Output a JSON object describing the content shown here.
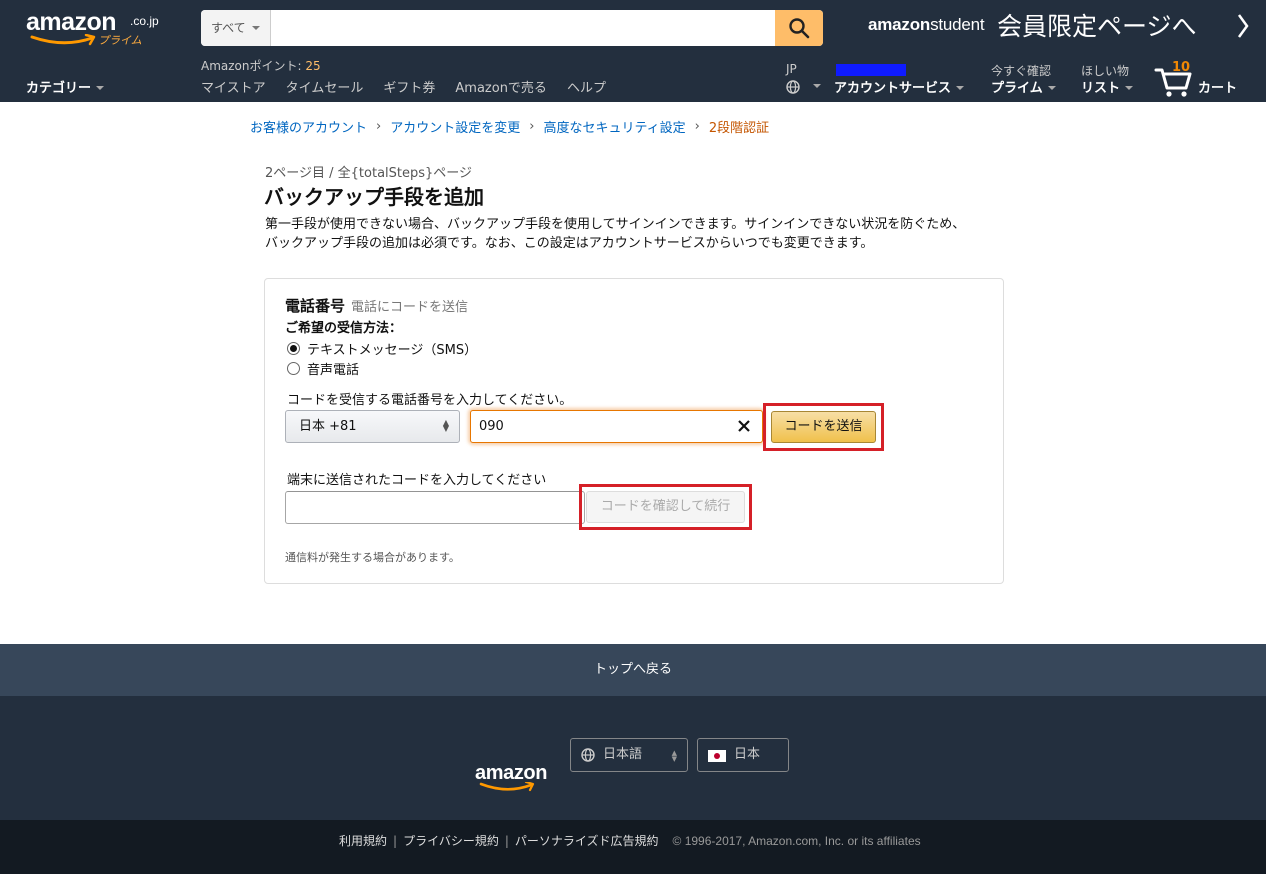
{
  "header": {
    "logo_text": "amazon",
    "logo_tld": ".co.jp",
    "logo_prime": "プライム",
    "search_category": "すべて",
    "search_value": "",
    "student_logo_a": "amazon",
    "student_logo_b": "student",
    "members_link": "会員限定ページへ",
    "points_label": "Amazonポイント: ",
    "points_value": "25",
    "nav_links": [
      "マイストア",
      "タイムセール",
      "ギフト券",
      "Amazonで売る",
      "ヘルプ"
    ],
    "category_label": "カテゴリー",
    "lang_code": "JP",
    "account_label": "アカウントサービス",
    "prime_top": "今すぐ確認",
    "prime_bottom": "プライム",
    "list_top": "ほしい物",
    "list_bottom": "リスト",
    "cart_count": "10",
    "cart_label": "カート"
  },
  "breadcrumb": [
    "お客様のアカウント",
    "アカウント設定を変更",
    "高度なセキュリティ設定",
    "2段階認証"
  ],
  "main": {
    "step_text": "2ページ目 / 全{totalSteps}ページ",
    "title": "バックアップ手段を追加",
    "desc_line1": "第一手段が使用できない場合、バックアップ手段を使用してサインインできます。サインインできない状況を防ぐため、",
    "desc_line2": "バックアップ手段の追加は必須です。なお、この設定はアカウントサービスからいつでも変更できます。"
  },
  "card": {
    "title": "電話番号",
    "subtitle": "電話にコードを送信",
    "pref_label": "ご希望の受信方法：",
    "radio_sms": "テキストメッセージ（SMS）",
    "radio_voice": "音声電話",
    "phone_label": "コードを受信する電話番号を入力してください。",
    "country_value": "日本 +81",
    "phone_value": "090",
    "send_button": "コードを送信",
    "code_label": "端末に送信されたコードを入力してください",
    "code_value": "",
    "verify_button": "コードを確認して続行",
    "fee_note": "通信料が発生する場合があります。"
  },
  "footer": {
    "back_to_top": "トップへ戻る",
    "logo_text": "amazon",
    "language": "日本語",
    "country": "日本",
    "links": [
      "利用規約",
      "プライバシー規約",
      "パーソナライズド広告規約"
    ],
    "copyright": "© 1996-2017, Amazon.com, Inc. or its affiliates"
  },
  "colors": {
    "header_bg": "#232f3e",
    "search_button": "#febd69",
    "link": "#0066c0",
    "breadcrumb_current": "#c45500",
    "highlight_red": "#d52028",
    "cart_count": "#f08804"
  }
}
